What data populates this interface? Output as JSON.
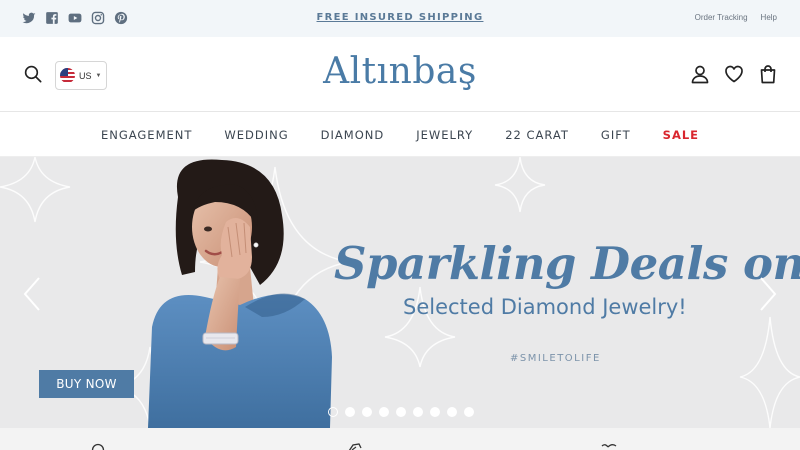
{
  "topbar": {
    "social_icons": [
      "twitter-icon",
      "facebook-icon",
      "youtube-icon",
      "instagram-icon",
      "pinterest-icon"
    ],
    "announcement": "FREE INSURED SHIPPING",
    "links": [
      "Order Tracking",
      "Help"
    ]
  },
  "header": {
    "logo": "Altınbaş",
    "currency": {
      "code": "US",
      "flag": "us-flag-icon"
    },
    "icons": [
      "search-icon",
      "account-icon",
      "wishlist-heart-icon",
      "cart-bag-icon"
    ]
  },
  "nav": {
    "items": [
      "ENGAGEMENT",
      "WEDDING",
      "DIAMOND",
      "JEWELRY",
      "22 CARAT",
      "GIFT",
      "SALE"
    ]
  },
  "hero": {
    "headline": "Sparkling Deals on",
    "subline": "Selected Diamond Jewelry!",
    "hashtag": "#SMILETOLIFE",
    "cta": "BUY NOW",
    "slide_count": 9,
    "active_slide": 1
  },
  "colors": {
    "brand_blue": "#4f7ba5",
    "sale_red": "#d9262e",
    "topbar_bg": "#f2f6f9",
    "hero_bg": "#e9e9ea"
  }
}
